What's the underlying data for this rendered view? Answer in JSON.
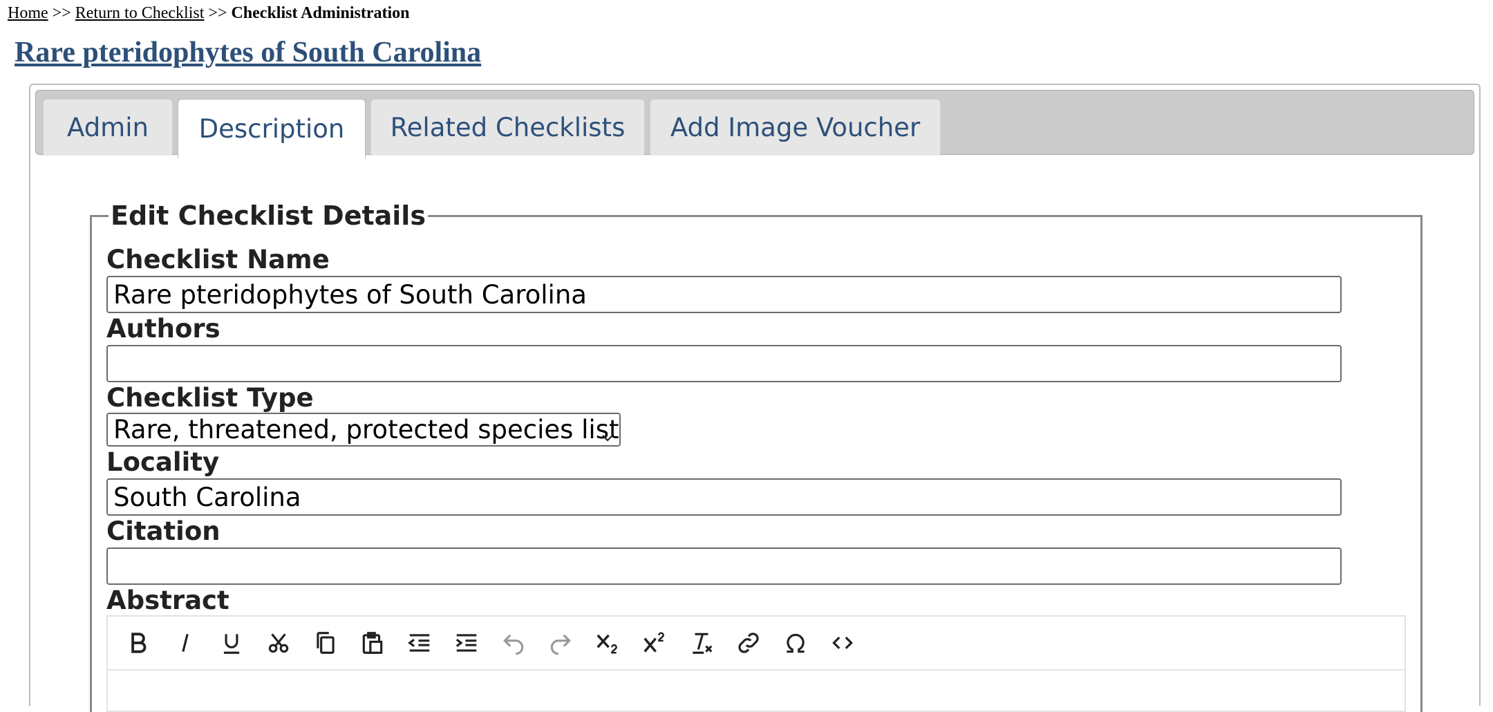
{
  "breadcrumb": {
    "home": "Home",
    "sep1": ">>",
    "return": "Return to Checklist",
    "sep2": ">>",
    "current": "Checklist Administration"
  },
  "page_title": "Rare pteridophytes of South Carolina",
  "tabs": [
    {
      "label": "Admin",
      "active": false
    },
    {
      "label": "Description",
      "active": true
    },
    {
      "label": "Related Checklists",
      "active": false
    },
    {
      "label": "Add Image Voucher",
      "active": false
    }
  ],
  "form": {
    "legend": "Edit Checklist Details",
    "name_label": "Checklist Name",
    "name_value": "Rare pteridophytes of South Carolina",
    "authors_label": "Authors",
    "authors_value": "",
    "type_label": "Checklist Type",
    "type_value": "Rare, threatened, protected species list",
    "locality_label": "Locality",
    "locality_value": "South Carolina",
    "citation_label": "Citation",
    "citation_value": "",
    "abstract_label": "Abstract"
  },
  "toolbar_icons": [
    "bold-icon",
    "italic-icon",
    "underline-icon",
    "cut-icon",
    "copy-icon",
    "paste-icon",
    "outdent-icon",
    "indent-icon",
    "undo-icon",
    "redo-icon",
    "subscript-icon",
    "superscript-icon",
    "clear-formatting-icon",
    "link-icon",
    "special-character-icon",
    "source-code-icon"
  ],
  "colors": {
    "link_title": "#2d5079",
    "tab_text": "#2d5079",
    "tab_bar": "#cbcbcb",
    "tab_bg": "#e6e6e6"
  }
}
